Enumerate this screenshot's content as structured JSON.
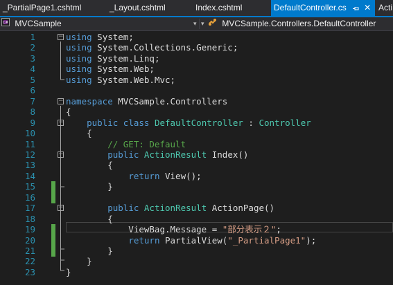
{
  "tabs": [
    {
      "label": "_PartialPage1.cshtml",
      "active": false
    },
    {
      "label": "_Layout.cshtml",
      "active": false
    },
    {
      "label": "Index.cshtml",
      "active": false
    },
    {
      "label": "DefaultController.cs",
      "active": true,
      "pin_icon": "pin-icon",
      "close_icon": "close-icon"
    },
    {
      "label": "Acti",
      "active": false
    }
  ],
  "navbar": {
    "project": "MVCSample",
    "project_icon": "csharp-project-icon",
    "type_path": "MVCSample.Controllers.DefaultController",
    "type_icon": "class-icon"
  },
  "colors": {
    "accent": "#007acc",
    "background": "#1e1e1e",
    "keyword": "#569cd6",
    "type": "#4ec9b0",
    "comment": "#57a64a",
    "string": "#d69d85",
    "line_number": "#2b91af",
    "change_marker": "#57a64a"
  },
  "editor": {
    "lines": [
      {
        "n": "1",
        "fold": "minus",
        "changed": false,
        "tokens": [
          {
            "t": "using",
            "c": "kw"
          },
          {
            "t": " System;",
            "c": "tx"
          }
        ]
      },
      {
        "n": "2",
        "fold": "",
        "changed": false,
        "tokens": [
          {
            "t": "using",
            "c": "kw"
          },
          {
            "t": " System.Collections.Generic;",
            "c": "tx"
          }
        ]
      },
      {
        "n": "3",
        "fold": "",
        "changed": false,
        "tokens": [
          {
            "t": "using",
            "c": "kw"
          },
          {
            "t": " System.Linq;",
            "c": "tx"
          }
        ]
      },
      {
        "n": "4",
        "fold": "",
        "changed": false,
        "tokens": [
          {
            "t": "using",
            "c": "kw"
          },
          {
            "t": " System.Web;",
            "c": "tx"
          }
        ]
      },
      {
        "n": "5",
        "fold": "",
        "changed": false,
        "tokens": [
          {
            "t": "using",
            "c": "kw"
          },
          {
            "t": " System.Web.Mvc;",
            "c": "tx"
          }
        ]
      },
      {
        "n": "6",
        "fold": "",
        "changed": false,
        "tokens": []
      },
      {
        "n": "7",
        "fold": "minus",
        "changed": false,
        "tokens": [
          {
            "t": "namespace",
            "c": "kw"
          },
          {
            "t": " MVCSample.Controllers",
            "c": "tx"
          }
        ]
      },
      {
        "n": "8",
        "fold": "",
        "changed": false,
        "tokens": [
          {
            "t": "{",
            "c": "tx"
          }
        ]
      },
      {
        "n": "9",
        "fold": "minus",
        "changed": false,
        "tokens": [
          {
            "t": "    ",
            "c": "tx"
          },
          {
            "t": "public",
            "c": "kw"
          },
          {
            "t": " ",
            "c": "tx"
          },
          {
            "t": "class",
            "c": "kw"
          },
          {
            "t": " ",
            "c": "tx"
          },
          {
            "t": "DefaultController",
            "c": "ty"
          },
          {
            "t": " : ",
            "c": "tx"
          },
          {
            "t": "Controller",
            "c": "ty"
          }
        ]
      },
      {
        "n": "10",
        "fold": "",
        "changed": false,
        "tokens": [
          {
            "t": "    {",
            "c": "tx"
          }
        ]
      },
      {
        "n": "11",
        "fold": "",
        "changed": false,
        "tokens": [
          {
            "t": "        // GET: Default",
            "c": "cm"
          }
        ]
      },
      {
        "n": "12",
        "fold": "minus",
        "changed": false,
        "tokens": [
          {
            "t": "        ",
            "c": "tx"
          },
          {
            "t": "public",
            "c": "kw"
          },
          {
            "t": " ",
            "c": "tx"
          },
          {
            "t": "ActionResult",
            "c": "ty"
          },
          {
            "t": " Index()",
            "c": "tx"
          }
        ]
      },
      {
        "n": "13",
        "fold": "",
        "changed": false,
        "tokens": [
          {
            "t": "        {",
            "c": "tx"
          }
        ]
      },
      {
        "n": "14",
        "fold": "",
        "changed": false,
        "tokens": [
          {
            "t": "            ",
            "c": "tx"
          },
          {
            "t": "return",
            "c": "kw"
          },
          {
            "t": " View();",
            "c": "tx"
          }
        ]
      },
      {
        "n": "15",
        "fold": "",
        "changed": true,
        "tokens": [
          {
            "t": "        }",
            "c": "tx"
          }
        ]
      },
      {
        "n": "16",
        "fold": "",
        "changed": true,
        "tokens": []
      },
      {
        "n": "17",
        "fold": "minus",
        "changed": false,
        "tokens": [
          {
            "t": "        ",
            "c": "tx"
          },
          {
            "t": "public",
            "c": "kw"
          },
          {
            "t": " ",
            "c": "tx"
          },
          {
            "t": "ActionResult",
            "c": "ty"
          },
          {
            "t": " ActionPage()",
            "c": "tx"
          }
        ]
      },
      {
        "n": "18",
        "fold": "",
        "changed": false,
        "tokens": [
          {
            "t": "        {",
            "c": "tx"
          }
        ]
      },
      {
        "n": "19",
        "fold": "",
        "changed": true,
        "tokens": [
          {
            "t": "            ViewBag.Message = ",
            "c": "tx"
          },
          {
            "t": "\"部分表示２\"",
            "c": "st"
          },
          {
            "t": ";",
            "c": "tx"
          }
        ]
      },
      {
        "n": "20",
        "fold": "",
        "changed": true,
        "tokens": [
          {
            "t": "            ",
            "c": "tx"
          },
          {
            "t": "return",
            "c": "kw"
          },
          {
            "t": " PartialView(",
            "c": "tx"
          },
          {
            "t": "\"_PartialPage1\"",
            "c": "st"
          },
          {
            "t": ");",
            "c": "tx"
          }
        ]
      },
      {
        "n": "21",
        "fold": "",
        "changed": true,
        "tokens": [
          {
            "t": "        }",
            "c": "tx"
          }
        ]
      },
      {
        "n": "22",
        "fold": "",
        "changed": false,
        "tokens": [
          {
            "t": "    }",
            "c": "tx"
          }
        ]
      },
      {
        "n": "23",
        "fold": "",
        "changed": false,
        "tokens": [
          {
            "t": "}",
            "c": "tx"
          }
        ]
      }
    ]
  }
}
